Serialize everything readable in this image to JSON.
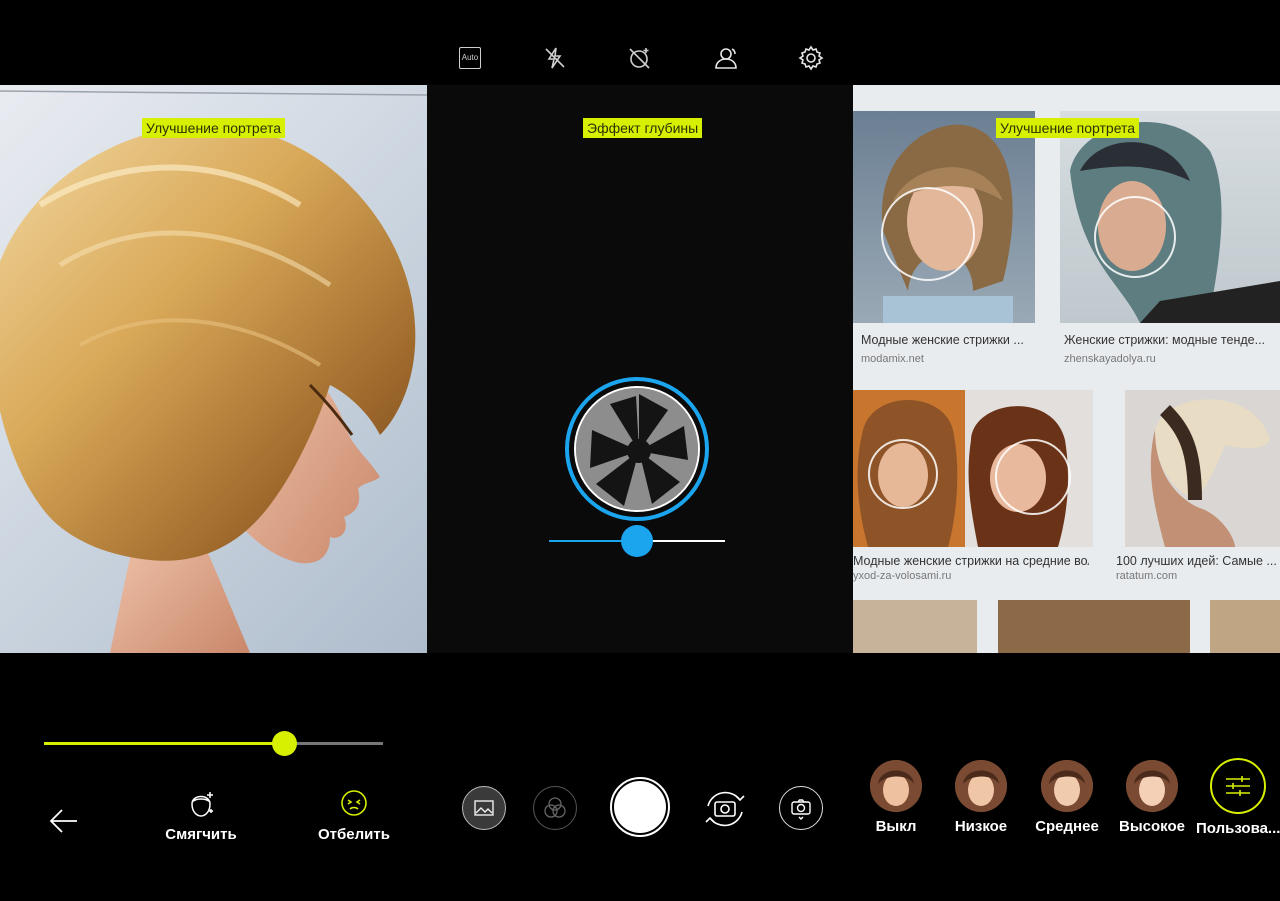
{
  "topbar": {
    "auto_label": "Auto",
    "icons": [
      "auto-mode-icon",
      "flash-off-icon",
      "hdr-off-icon",
      "portrait-mode-icon",
      "settings-icon"
    ]
  },
  "left_panel": {
    "mode_tag": "Улучшение портрета"
  },
  "middle_panel": {
    "mode_tag": "Эффект глубины",
    "depth_level": 0.5
  },
  "right_panel": {
    "mode_tag": "Улучшение портрета",
    "results": [
      {
        "caption": "Модные женские стрижки ...",
        "source": "modamix.net"
      },
      {
        "caption": "Женские стрижки: модные тенде...",
        "source": "zhenskayadolya.ru"
      },
      {
        "caption": "Модные женские стрижки на средние вол...",
        "source": "yxod-za-volosami.ru"
      },
      {
        "caption": "100 лучших идей: Самые ...",
        "source": "ratatum.com"
      }
    ]
  },
  "bottom": {
    "beauty_level": 0.71,
    "tools": [
      {
        "label": "Смягчить"
      },
      {
        "label": "Отбелить"
      }
    ],
    "levels": [
      {
        "label": "Выкл"
      },
      {
        "label": "Низкое"
      },
      {
        "label": "Среднее"
      },
      {
        "label": "Высокое"
      },
      {
        "label": "Пользова..."
      }
    ]
  },
  "colors": {
    "accent_yellow": "#d7ef00",
    "accent_blue": "#1aa5ee"
  }
}
